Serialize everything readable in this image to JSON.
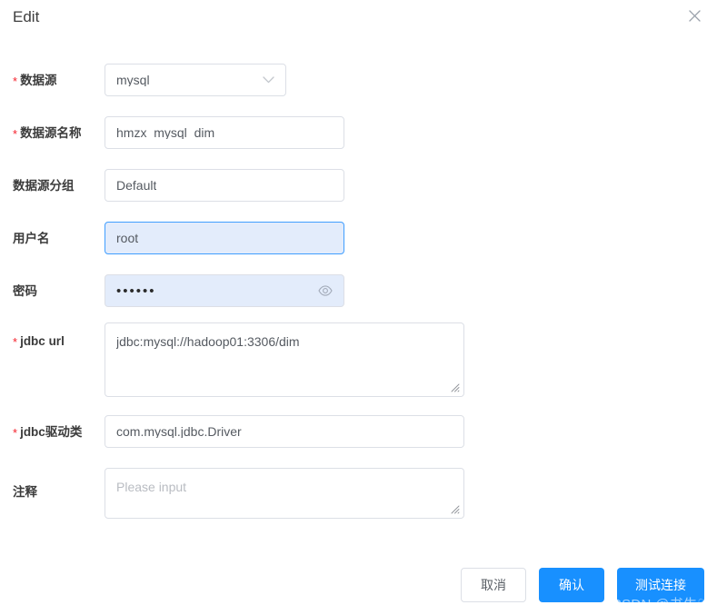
{
  "dialog": {
    "title": "Edit",
    "close_icon": "close-icon"
  },
  "form": {
    "fields": [
      {
        "key": "datasource_type",
        "label": "数据源",
        "required": true,
        "control": "select",
        "value": "mysql",
        "icon": "chevron-down-icon"
      },
      {
        "key": "datasource_name",
        "label": "数据源名称",
        "required": true,
        "control": "input",
        "value": "hmzx_mysql_dim"
      },
      {
        "key": "datasource_group",
        "label": "数据源分组",
        "required": false,
        "control": "input",
        "value": "Default"
      },
      {
        "key": "username",
        "label": "用户名",
        "required": false,
        "control": "input",
        "value": "root",
        "state": "focused-autofill"
      },
      {
        "key": "password",
        "label": "密码",
        "required": false,
        "control": "password",
        "value": "••••••",
        "icon": "eye-icon",
        "state": "autofill"
      },
      {
        "key": "jdbc_url",
        "label": "jdbc url",
        "required": true,
        "control": "textarea",
        "value": "jdbc:mysql://hadoop01:3306/dim"
      },
      {
        "key": "jdbc_driver_class",
        "label": "jdbc驱动类",
        "required": true,
        "control": "input",
        "value": "com.mysql.jdbc.Driver"
      },
      {
        "key": "comment",
        "label": "注释",
        "required": false,
        "control": "textarea",
        "value": "",
        "placeholder": "Please input"
      }
    ],
    "required_marker": "*"
  },
  "footer": {
    "cancel_label": "取消",
    "confirm_label": "确认",
    "test_connection_label": "测试连接"
  },
  "watermark": {
    "text": "CSDN @书生♡"
  },
  "colors": {
    "primary": "#1890ff",
    "focus_border": "#409eff",
    "autofill_bg": "#e3ecfb",
    "required_red": "#f5222d",
    "border": "#dcdfe6"
  }
}
